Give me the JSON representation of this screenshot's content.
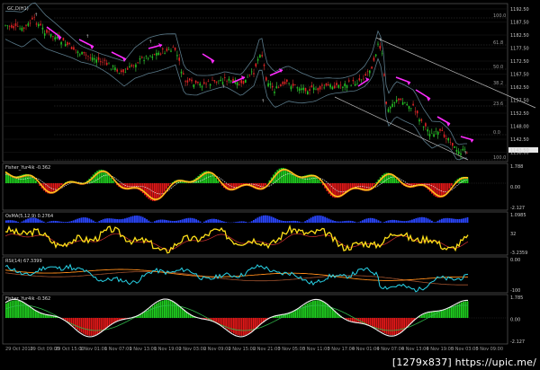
{
  "watermark": "[1279x837] https://upic.me/",
  "chart_data": [
    {
      "type": "line",
      "panel": "price",
      "title": "GC,D(H1)",
      "y_ticks": [
        "1192.50",
        "1187.50",
        "1182.50",
        "1177.50",
        "1172.50",
        "1167.50",
        "1162.50",
        "1157.50",
        "1152.50",
        "1148.00",
        "1142.50",
        "1138.00"
      ],
      "last_price": "1143.50",
      "fib_labels": [
        "100.0",
        "61.8",
        "50.0",
        "38.2",
        "23.6",
        "0.0"
      ]
    },
    {
      "type": "bar",
      "panel": "indicator",
      "title": "Fisher_Yur4ik -0.362",
      "y_ticks": [
        "1.788",
        "0.00",
        "-2.127"
      ]
    },
    {
      "type": "bar",
      "panel": "indicator",
      "title": "OsMA(5,12,9) 0.2764",
      "y_ticks": [
        "1.0985",
        "32",
        "-3.2359"
      ]
    },
    {
      "type": "line",
      "panel": "indicator",
      "title": "RSI(14) 67.3399",
      "y_ticks": [
        "0.00",
        "-100"
      ]
    },
    {
      "type": "bar",
      "panel": "indicator",
      "title": "Fisher_Yur4ik -0.362",
      "y_ticks": [
        "1.785",
        "0.00",
        "-2.127"
      ]
    }
  ],
  "x_labels": [
    "29 Oct 2010",
    "29 Oct 09:00",
    "29 Oct 15:00",
    "1 Nov 01:00",
    "1 Nov 07:00",
    "1 Nov 13:00",
    "1 Nov 19:00",
    "2 Nov 03:00",
    "2 Nov 09:00",
    "2 Nov 15:00",
    "2 Nov 21:00",
    "3 Nov 05:00",
    "3 Nov 11:00",
    "3 Nov 17:00",
    "4 Nov 01:00",
    "4 Nov 07:00",
    "4 Nov 13:00",
    "4 Nov 19:00",
    "5 Nov 03:00",
    "5 Nov 09:00"
  ]
}
